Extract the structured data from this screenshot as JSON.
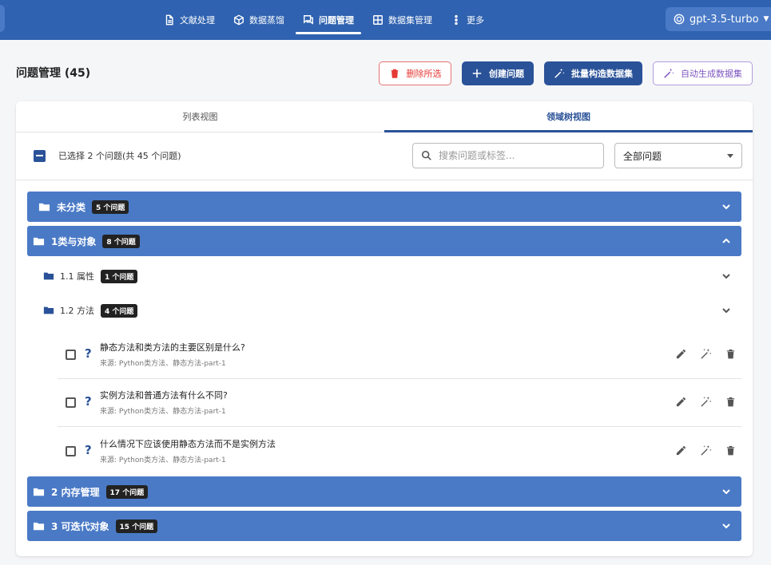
{
  "nav": {
    "items": [
      {
        "label": "文献处理",
        "icon": "document-icon"
      },
      {
        "label": "数据蒸馏",
        "icon": "cube-icon"
      },
      {
        "label": "问题管理",
        "icon": "chat-icon",
        "active": true
      },
      {
        "label": "数据集管理",
        "icon": "grid-icon"
      },
      {
        "label": "更多",
        "icon": "more-icon"
      }
    ],
    "model": "gpt-3.5-turbo"
  },
  "header": {
    "title": "问题管理 (45)",
    "delete_label": "删除所选",
    "create_label": "创建问题",
    "batch_label": "批量构造数据集",
    "auto_label": "自动生成数据集"
  },
  "tabs": {
    "list": "列表视图",
    "tree": "领域树视图"
  },
  "toolbar": {
    "selected_text": "已选择 2 个问题(共 45 个问题)",
    "search_placeholder": "搜索问题或标签...",
    "filter_value": "全部问题"
  },
  "tree": {
    "categories": [
      {
        "label": "未分类",
        "count": "5 个问题"
      },
      {
        "label": "1类与对象",
        "count": "8 个问题"
      },
      {
        "label": "2 内存管理",
        "count": "17 个问题"
      },
      {
        "label": "3 可迭代对象",
        "count": "15 个问题"
      }
    ],
    "subs": [
      {
        "label": "1.1 属性",
        "count": "1 个问题"
      },
      {
        "label": "1.2 方法",
        "count": "4 个问题"
      }
    ],
    "questions": [
      {
        "text": "静态方法和类方法的主要区别是什么?",
        "source": "来源: Python类方法、静态方法-part-1"
      },
      {
        "text": "实例方法和普通方法有什么不同?",
        "source": "来源: Python类方法、静态方法-part-1"
      },
      {
        "text": "什么情况下应该使用静态方法而不是实例方法",
        "source": "来源: Python类方法、静态方法-part-1"
      }
    ]
  },
  "colors": {
    "topbar": "#2f62b0",
    "primary": "#2a5298",
    "category": "#4a7ac6",
    "danger": "#e53935",
    "purple": "#7e57c2"
  }
}
